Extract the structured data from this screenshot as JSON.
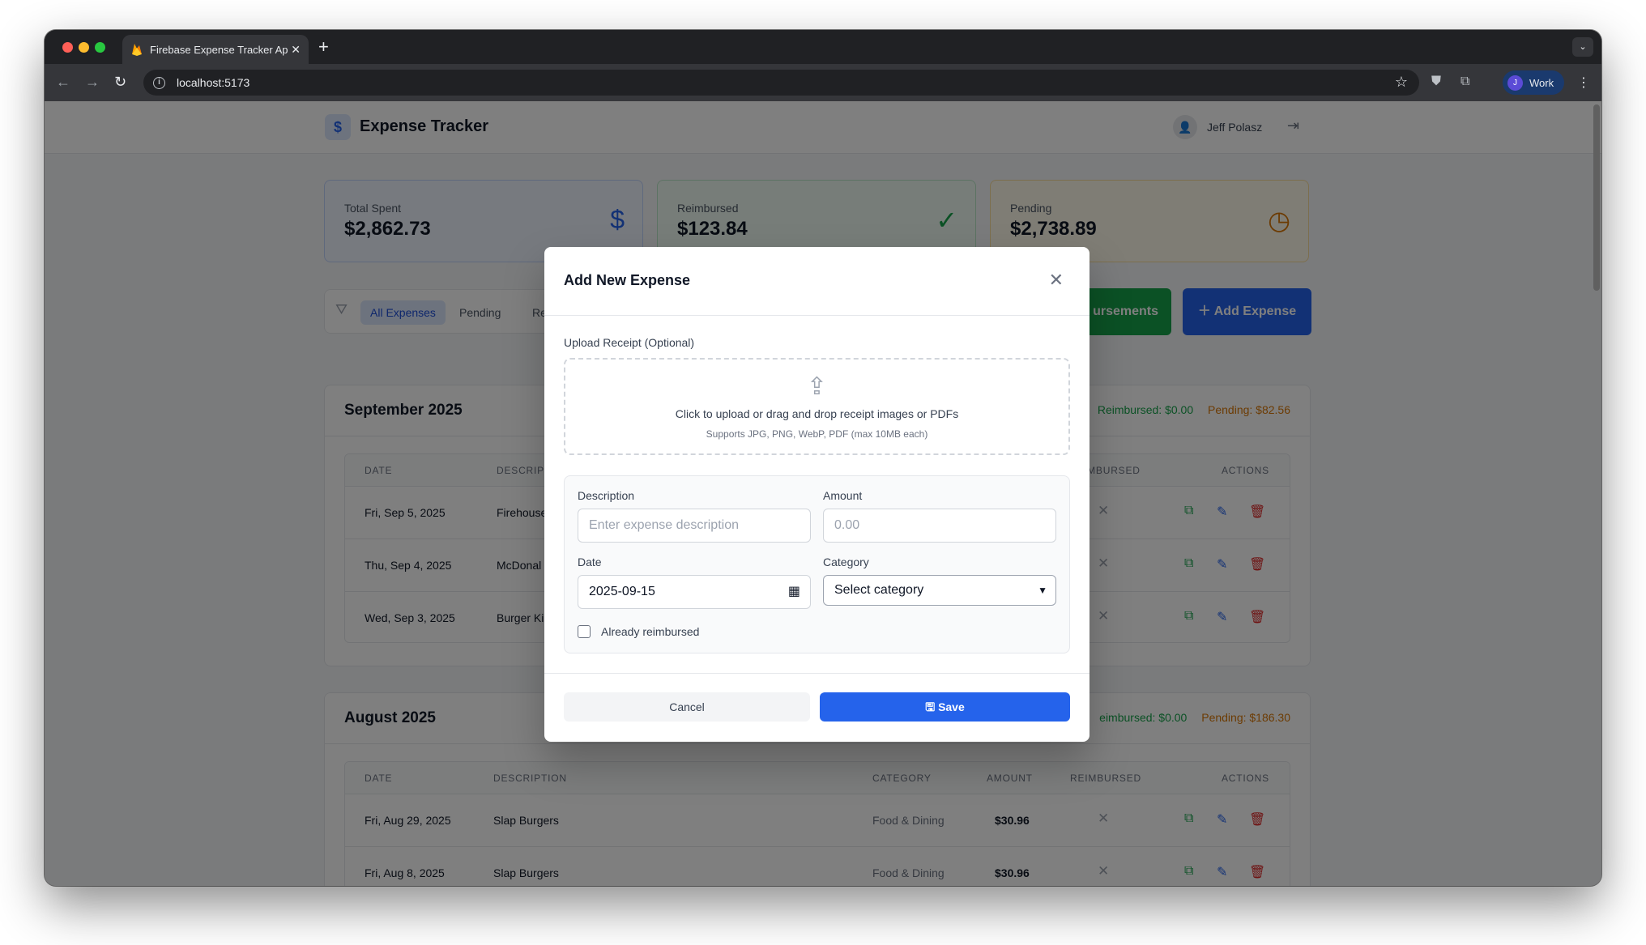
{
  "browser": {
    "tab_title": "Firebase Expense Tracker App",
    "url": "localhost:5173",
    "profile_initial": "J",
    "profile_label": "Work"
  },
  "header": {
    "logo_symbol": "$",
    "title": "Expense Tracker",
    "user_name": "Jeff Polasz"
  },
  "stats": [
    {
      "label": "Total Spent",
      "value": "$2,862.73",
      "icon": "dollar-icon",
      "color": "#2563eb"
    },
    {
      "label": "Reimbursed",
      "value": "$123.84",
      "icon": "check-circle-icon",
      "color": "#16a34a"
    },
    {
      "label": "Pending",
      "value": "$2,738.89",
      "icon": "clock-icon",
      "color": "#d97706"
    }
  ],
  "filters": {
    "items": [
      "All Expenses",
      "Pending",
      "Re"
    ],
    "active": "All Expenses"
  },
  "actions": {
    "reimbursements_label": "ursements",
    "add_label": "Add Expense"
  },
  "sections": [
    {
      "title": "September 2025",
      "reimbursed": "Reimbursed: $0.00",
      "pending": "Pending: $82.56",
      "columns": {
        "date": "DATE",
        "description": "DESCRIP",
        "reimbursed": "IMBURSED",
        "actions": "ACTIONS"
      },
      "rows": [
        {
          "date": "Fri, Sep 5, 2025",
          "description": "Firehouse"
        },
        {
          "date": "Thu, Sep 4, 2025",
          "description": "McDonal"
        },
        {
          "date": "Wed, Sep 3, 2025",
          "description": "Burger Ki"
        }
      ]
    },
    {
      "title": "August 2025",
      "reimbursed": "eimbursed: $0.00",
      "pending": "Pending: $186.30",
      "columns": {
        "date": "DATE",
        "description": "DESCRIPTION",
        "category": "CATEGORY",
        "amount": "AMOUNT",
        "reimbursed": "REIMBURSED",
        "actions": "ACTIONS"
      },
      "rows": [
        {
          "date": "Fri, Aug 29, 2025",
          "description": "Slap Burgers",
          "category": "Food & Dining",
          "amount": "$30.96"
        },
        {
          "date": "Fri, Aug 8, 2025",
          "description": "Slap Burgers",
          "category": "Food & Dining",
          "amount": "$30.96"
        }
      ]
    }
  ],
  "modal": {
    "title": "Add New Expense",
    "upload_label": "Upload Receipt (Optional)",
    "upload_main": "Click to upload or drag and drop receipt images or PDFs",
    "upload_sub": "Supports JPG, PNG, WebP, PDF (max 10MB each)",
    "description_label": "Description",
    "description_placeholder": "Enter expense description",
    "amount_label": "Amount",
    "amount_placeholder": "0.00",
    "date_label": "Date",
    "date_value": "2025-09-15",
    "category_label": "Category",
    "category_value": "Select category",
    "reimbursed_label": "Already reimbursed",
    "cancel_label": "Cancel",
    "save_label": "Save"
  }
}
